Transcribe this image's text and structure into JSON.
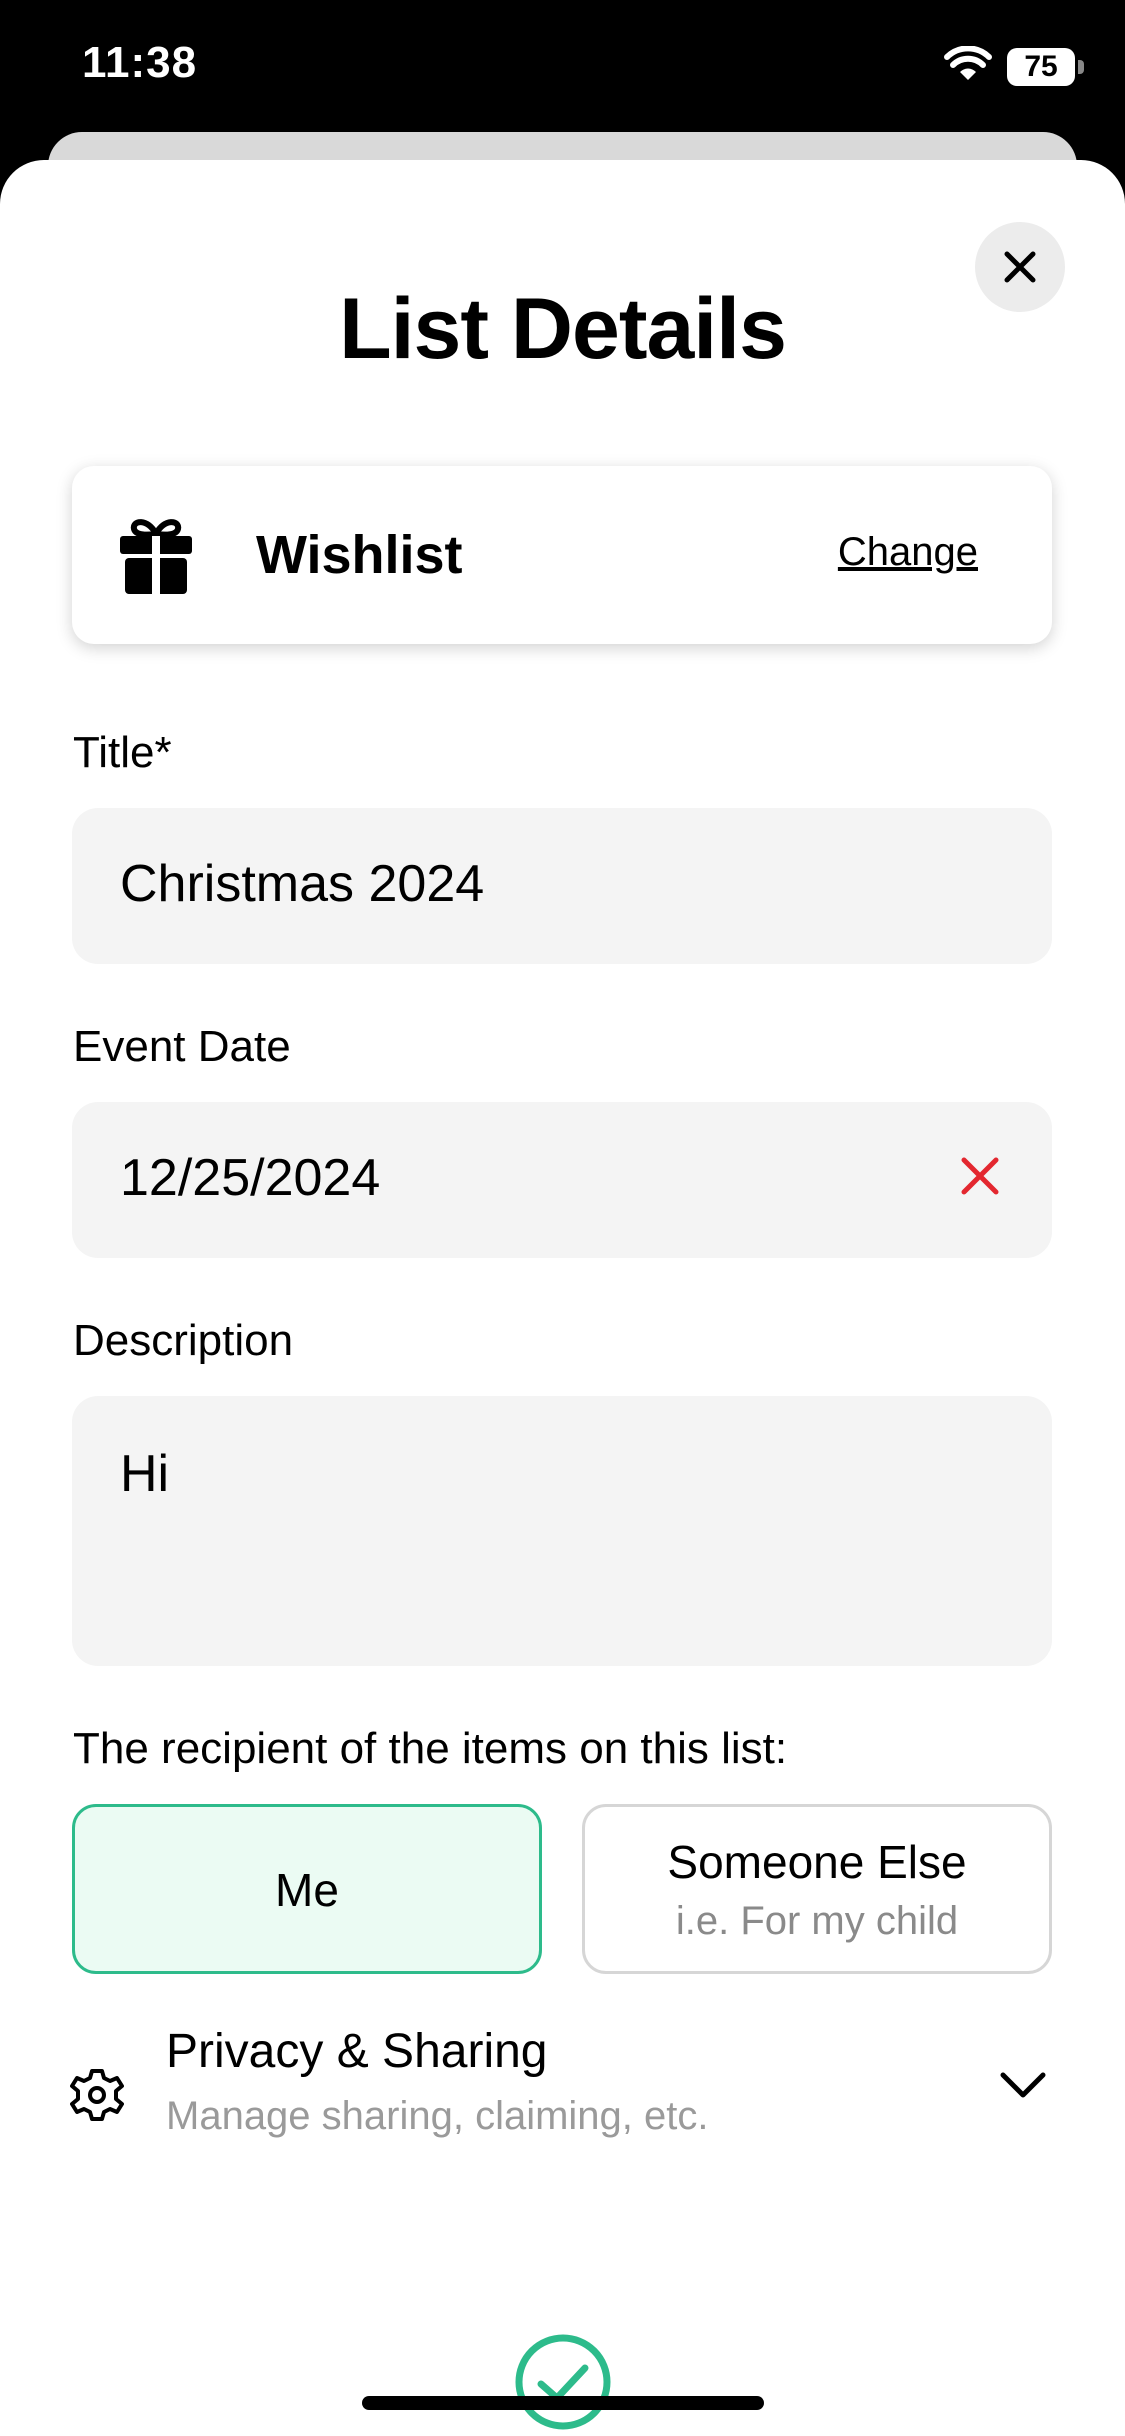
{
  "status_bar": {
    "time": "11:38",
    "battery": "75"
  },
  "sheet": {
    "title": "List Details"
  },
  "list_type": {
    "name": "Wishlist",
    "change_label": "Change"
  },
  "fields": {
    "title": {
      "label": "Title*",
      "value": "Christmas 2024"
    },
    "event_date": {
      "label": "Event Date",
      "value": "12/25/2024"
    },
    "description": {
      "label": "Description",
      "value": "Hi"
    }
  },
  "recipient": {
    "question": "The recipient of the items on this list:",
    "options": [
      {
        "label": "Me",
        "selected": true
      },
      {
        "label": "Someone Else",
        "sublabel": "i.e. For my child",
        "selected": false
      }
    ]
  },
  "privacy": {
    "title": "Privacy & Sharing",
    "subtitle": "Manage sharing, claiming, etc."
  },
  "colors": {
    "accent": "#2dbb8b",
    "accent_bg": "#ebfbf3",
    "clear_red": "#e3272f",
    "field_bg": "#f4f4f4"
  },
  "icons": [
    "wifi-icon",
    "close-icon",
    "gift-icon",
    "clear-icon",
    "gear-icon",
    "chevron-down-icon",
    "checkmark-circle-icon"
  ]
}
